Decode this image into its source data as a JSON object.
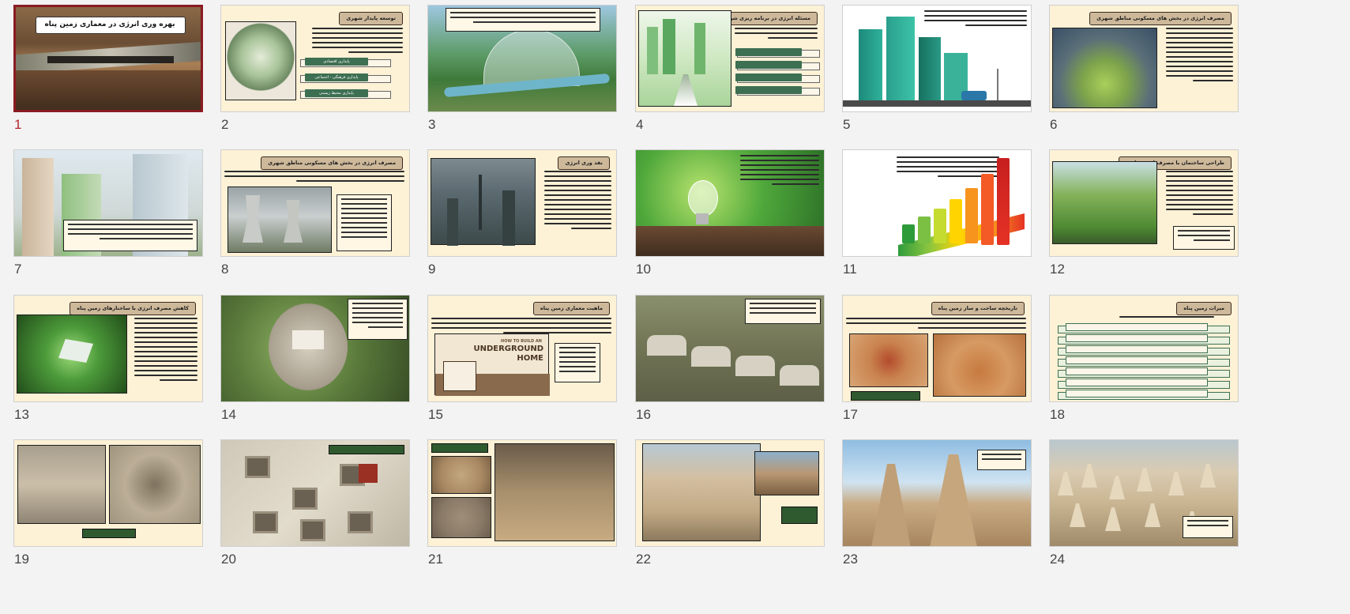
{
  "slide_numbers": [
    "1",
    "2",
    "3",
    "4",
    "5",
    "6",
    "7",
    "8",
    "9",
    "10",
    "11",
    "12",
    "13",
    "14",
    "15",
    "16",
    "17",
    "18",
    "19",
    "20",
    "21",
    "22",
    "23",
    "24"
  ],
  "selected_slide": "1",
  "slide1": {
    "title": "بهره وری انرژی در معماری زمین پناه"
  },
  "slide2": {
    "title": "توسعه پایدار شهری",
    "boxes": [
      "پایداری اقتصادی",
      "پایداری فرهنگی - اجتماعی",
      "پایداری محیط زیستی"
    ]
  },
  "slide4": {
    "title": "مسئله انرژی در برنامه ریزی شهری"
  },
  "slide6": {
    "title": "مصرف انرژی در بخش های مسکونی مناطق شهری"
  },
  "slide8": {
    "title": "مصرف انرژی در بخش های مسکونی مناطق شهری"
  },
  "slide9": {
    "title": "نقد وری انرژی"
  },
  "slide12": {
    "title": "طراحی ساختمان با مصرف انرژی پایین"
  },
  "slide13": {
    "title": "کاهش مصرف انرژی با ساختارهای زمین پناه"
  },
  "slide15": {
    "title": "ماهیت معماری زمین پناه",
    "graphic_line1": "HOW TO BUILD AN",
    "graphic_line2": "UNDERGROUND",
    "graphic_line3": "HOME"
  },
  "slide17": {
    "title": "تاریخچه ساخت و ساز زمین پناه"
  },
  "slide18": {
    "title": "میراث زمین پناه"
  }
}
